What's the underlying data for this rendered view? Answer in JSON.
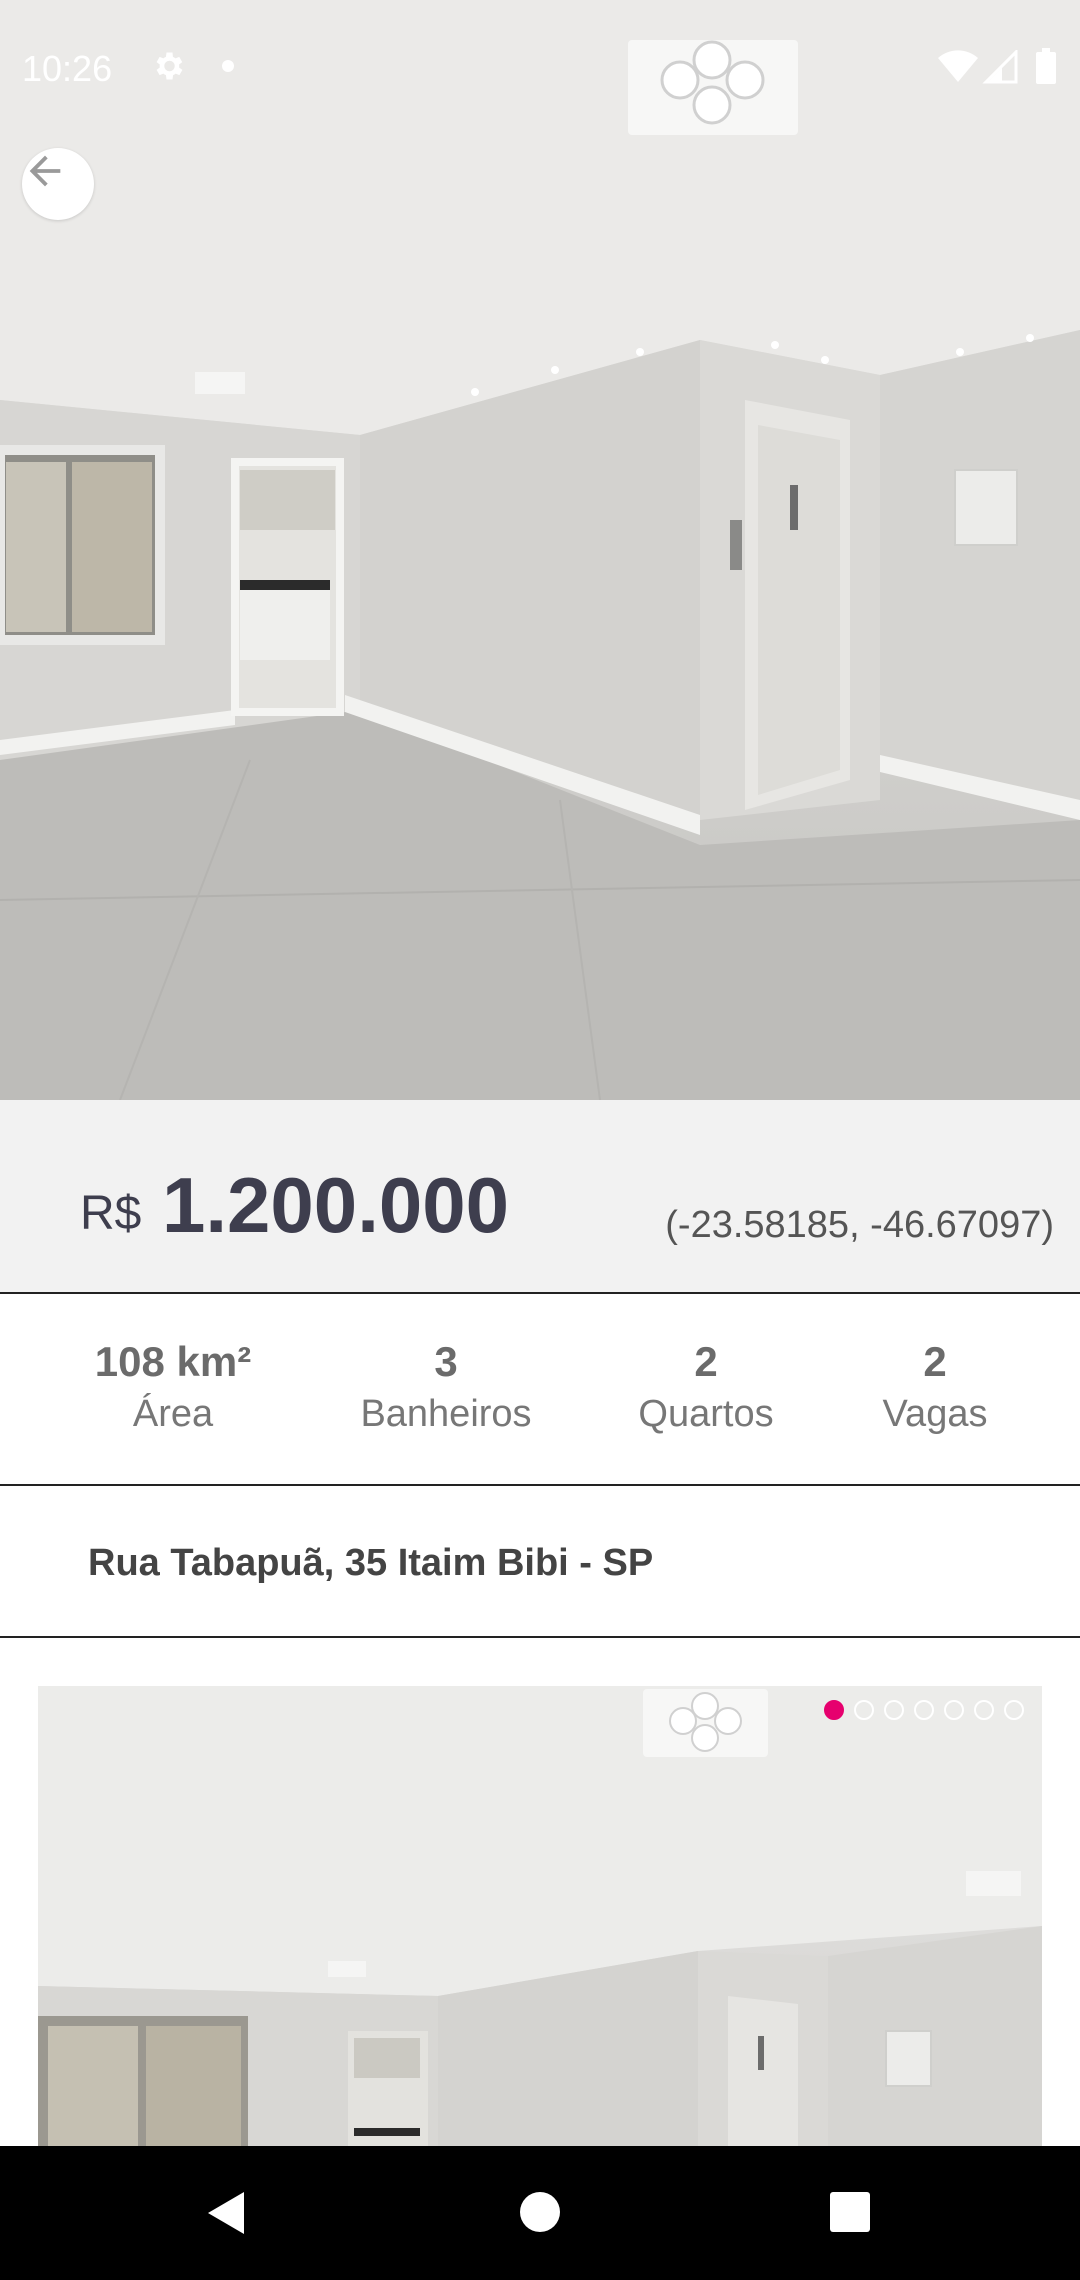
{
  "status_bar": {
    "time": "10:26",
    "icons": [
      "gear-icon",
      "notification-dot",
      "wifi-icon",
      "signal-icon",
      "battery-icon"
    ]
  },
  "header": {
    "back_icon": "arrow-left-icon"
  },
  "listing": {
    "currency": "R$",
    "price": "1.200.000",
    "coordinates": "(-23.58185, -46.67097)",
    "stats": [
      {
        "value": "108 km²",
        "label": "Área"
      },
      {
        "value": "3",
        "label": "Banheiros"
      },
      {
        "value": "2",
        "label": "Quartos"
      },
      {
        "value": "2",
        "label": "Vagas"
      }
    ],
    "address": "Rua Tabapuã, 35 Itaim Bibi - SP"
  },
  "gallery": {
    "image_count": 7,
    "active_index": 0,
    "indicator_color": "#e6006e"
  },
  "nav_bar": {
    "icons": [
      "back-triangle-icon",
      "home-circle-icon",
      "recents-square-icon"
    ]
  }
}
